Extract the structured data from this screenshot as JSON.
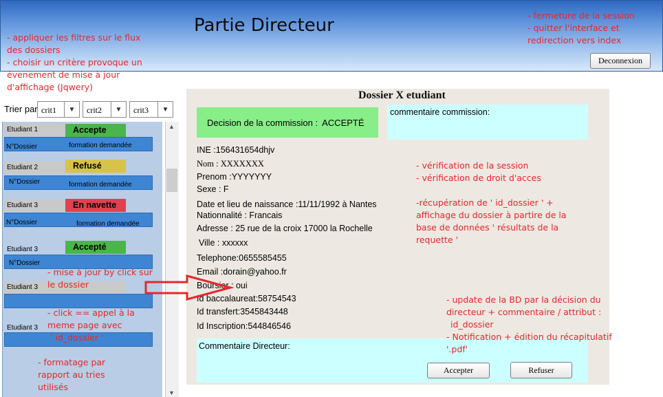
{
  "header": {
    "title": "Partie Directeur",
    "logout_label": "Deconnexion"
  },
  "notes": {
    "filters_1": "- appliquer les filtres sur le flux",
    "filters_2": "des dossiers",
    "filters_3": "- choisir un critère provoque un",
    "filters_4": "évenement de mise à jour",
    "filters_5": "d'affichage (Jqwery)",
    "session_1": "- fermeture de la session",
    "session_2": "- quitter l'interface et",
    "session_3": "redirection vers index",
    "verif_1": "- vérification de la session",
    "verif_2": "- vérification de droit d'acces",
    "recup_1": "-récupération de ' id_dossier ' +",
    "recup_2": "affichage du dossier à partire de la",
    "recup_3": "base de données ' résultats de la",
    "recup_4": "requette  '",
    "update_1": "- update de la BD par la décision du",
    "update_2": "directeur + commentaire /  attribut :",
    "update_3": "id_dossier",
    "update_4": "- Notification + édition du récapitulatif",
    "update_5": "'.pdf'",
    "click_1": "- mise à jour by click sur",
    "click_2": "le dossier",
    "call_1": "- click == appel à la",
    "call_2": "meme page avec",
    "call_3": "' id_dossier '",
    "format_1": "- formatage par",
    "format_2": "rapport au tries",
    "format_3": "utilisés"
  },
  "sort": {
    "label": "Trier par",
    "criteria": [
      "crit1",
      "crit2",
      "crit3"
    ]
  },
  "list": {
    "items": [
      {
        "student": "Etudiant 1",
        "status": "Accepte",
        "dossier": "N°Dossier",
        "formation": "formation  demandée"
      },
      {
        "student": "Etudiant 2",
        "status": "Refusé",
        "dossier": "N°Dossier",
        "formation": "formation  demandée"
      },
      {
        "student": "Etudiant 3",
        "status": "En navette",
        "dossier": "N°Dossier",
        "formation": "formation  demandée"
      },
      {
        "student": "Etudiant 3",
        "status": "Accepté",
        "dossier": "N°Dossier"
      },
      {
        "student": "Etudiant 3"
      },
      {
        "student": "Etudiant 3"
      }
    ],
    "status_colors": {
      "accepte": "#4ab54a",
      "refuse": "#d8c34a",
      "navette": "#e0404f"
    }
  },
  "dossier": {
    "title": "Dossier X etudiant",
    "decision_label": "Decision de la commission :",
    "decision_value": "ACCEPTÉ",
    "commission_comment_label": "commentaire commission:",
    "fields": {
      "ine": "INE :156431654dhjv",
      "nom": "Nom : XXXXXXX",
      "prenom": "Prenom :YYYYYYY",
      "sexe": "Sexe : F",
      "naissance": "Date et lieu de naissance :11/11/1992 à Nantes",
      "nationalite": "Nationnalité :  Francais",
      "adresse": "Adresse : 25 rue de la croix  17000 la Rochelle",
      "ville": "Ville : xxxxxx",
      "telephone": "Telephone:0655585455",
      "email": "Email :dorain@yahoo.fr",
      "boursier": "Boursier : oui",
      "bac": "Id baccalaureat:58754543",
      "transfert": "Id transfert:3545843448",
      "inscription": "Id Inscription:544846546"
    },
    "director_comment_label": "Commentaire Directeur:",
    "accept_label": "Accepter",
    "refuse_label": "Refuser"
  }
}
